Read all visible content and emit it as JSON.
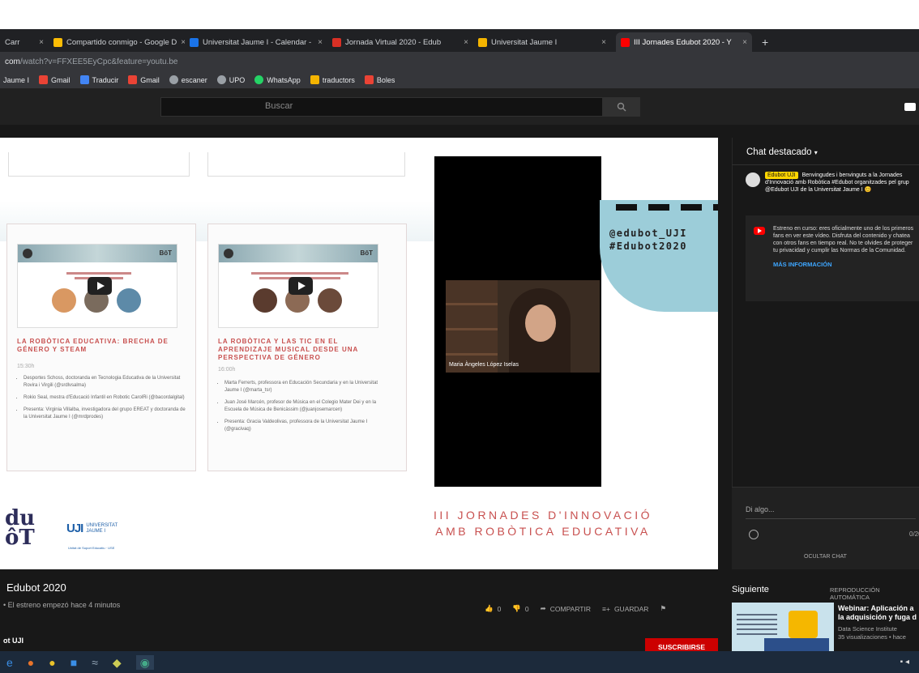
{
  "browser": {
    "tabs": [
      {
        "label": "Carr",
        "color": "#4285f4"
      },
      {
        "label": "Compartido conmigo - Google D",
        "color": "#fbbc05"
      },
      {
        "label": "Universitat Jaume I - Calendar -",
        "color": "#1a73e8"
      },
      {
        "label": "Jornada Virtual 2020 - Edub",
        "color": "#d93025"
      },
      {
        "label": "Universitat Jaume I",
        "color": "#f4b400"
      },
      {
        "label": "III Jornades Edubot 2020 - Y",
        "color": "#ff0000"
      }
    ],
    "tab_close": "×",
    "new_tab": "+",
    "url_host": "com",
    "url_path": "/watch?v=FFXEE5EyCpc&feature=youtu.be",
    "bookmarks": [
      {
        "label": "Jaume I",
        "color": "#f4b400"
      },
      {
        "label": "Gmail",
        "color": "#ea4335"
      },
      {
        "label": "Traducir",
        "color": "#4285f4"
      },
      {
        "label": "Gmail",
        "color": "#ea4335"
      },
      {
        "label": "escaner",
        "color": "#9aa0a6"
      },
      {
        "label": "UPO",
        "color": "#9aa0a6"
      },
      {
        "label": "WhatsApp",
        "color": "#25d366"
      },
      {
        "label": "traductors",
        "color": "#f4b400"
      },
      {
        "label": "Boles",
        "color": "#ea4335"
      }
    ]
  },
  "youtube": {
    "search_placeholder": "Buscar"
  },
  "slide": {
    "cards": [
      {
        "title": "La robòtica educativa: brecha de género y STEAM",
        "time": "15:30h",
        "bullets": [
          "Desportes Schoss, doctoranda en Tecnologia Educativa de la Universitat Rovira i Virgili (@srdlvsalma)",
          "Rokio Seal, mestra d'Educació Infantil en Robotic CarolRi (@bacordalgital)",
          "Presenta: Virginia Villalba, investigadora del grupo EREAT y doctoranda de la Universitat Jaume I (@mrdprodes)"
        ]
      },
      {
        "title": "La robòtica y las TIC en el aprendizaje musical desde una perspectiva de género",
        "time": "16:00h",
        "bullets": [
          "Marta Ferrerts, professora en Educación Secundaria y en la Universitat Jaume I (@marta_tsr)",
          "Juan José Marcén, profesor de Música en el Colegio Mater Dei y en la Escuela de Música de Benicàssim (@juanjosemarcen)",
          "Presenta: Gracia Valdeolivas, professora de la Universitat Jaume I (@gracivaq)"
        ]
      }
    ],
    "handle": "@edubot_UJI",
    "hashtag": "#Edubot2020",
    "webcam_name": "Maria Àngeles López Iselas",
    "jornades_line1": "III JORNADES D'INNOVACIÓ",
    "jornades_line2": "AMB ROBÒTICA EDUCATIVA",
    "logo_du": "du",
    "logo_bot": "ôT",
    "uji_mark": "UJI",
    "uji_line1": "UNIVERSITAT",
    "uji_line2": "JAUME I",
    "uji_sub": "Unitat de Suport Educatiu · USE"
  },
  "chat": {
    "header": "Chat destacado",
    "message_author": "Edubot UJI",
    "message_text": "Benvingudes i benvinguts a la Jornades d'Innovació amb Robòtica #Edubot organitzades pel grup @Edubot UJI de la Universitat Jaume I 😊",
    "notice_text": "Estreno en curso: eres oficialmente uno de los primeros fans en ver este vídeo. Disfruta del contenido y chatea con otros fans en tiempo real. No te olvides de proteger tu privacidad y cumplir las Normas de la Comunidad.",
    "notice_link": "MÁS INFORMACIÓN",
    "input_placeholder": "Di algo...",
    "char_count": "0/200",
    "hide_chat": "OCULTAR CHAT"
  },
  "video": {
    "title": "Edubot 2020",
    "subtitle": "• El estreno empezó hace 4 minutos",
    "likes": "0",
    "dislikes": "0",
    "share": "COMPARTIR",
    "save": "GUARDAR",
    "channel": "ot UJI",
    "subscribe": "SUSCRIBIRSE"
  },
  "sidebar": {
    "next_label": "Siguiente",
    "autoplay": "REPRODUCCIÓN AUTOMÁTICA",
    "next_title": "Webinar: Aplicación a la adquisición y fuga d",
    "next_channel": "Data Science Institute",
    "next_views": "35 visualizaciones • hace"
  },
  "colors": {
    "accent_red": "#c8504f",
    "yt_red": "#ff0000",
    "blob": "#9ccdd9",
    "uji_blue": "#1d5fa8"
  }
}
